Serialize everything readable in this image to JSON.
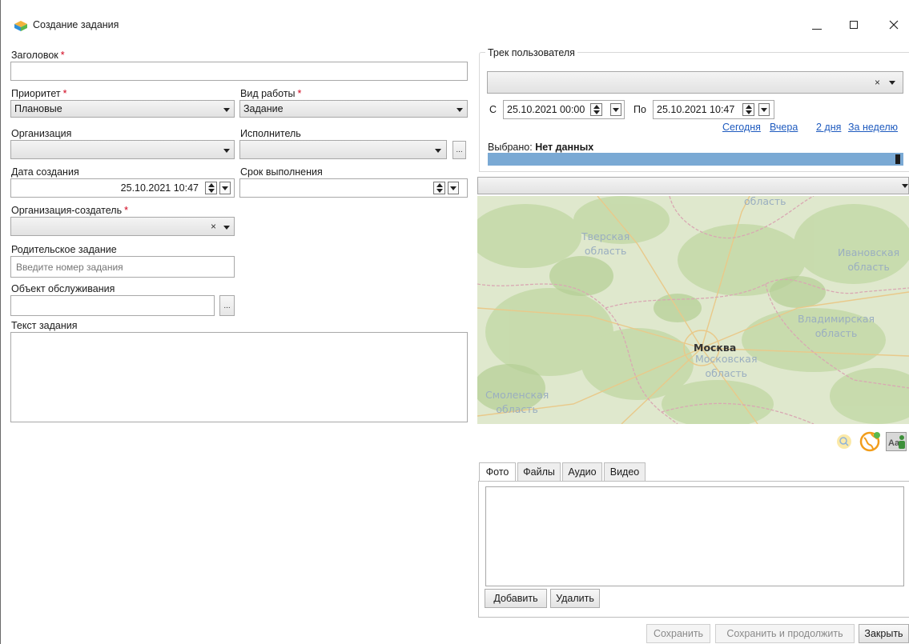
{
  "window": {
    "title": "Создание задания",
    "controls": [
      "minimize",
      "maximize",
      "close"
    ]
  },
  "form": {
    "title_label": "Заголовок",
    "title_value": "",
    "priority_label": "Приоритет",
    "priority_value": "Плановые",
    "worktype_label": "Вид работы",
    "worktype_value": "Задание",
    "org_label": "Организация",
    "org_value": "",
    "executor_label": "Исполнитель",
    "executor_value": "",
    "created_label": "Дата создания",
    "created_value": "25.10.2021 10:47",
    "deadline_label": "Срок выполнения",
    "deadline_value": "",
    "creator_org_label": "Организация-создатель",
    "creator_org_value": "",
    "parent_label": "Родительское задание",
    "parent_placeholder": "Введите номер задания",
    "object_label": "Объект обслуживания",
    "object_value": "",
    "text_label": "Текст задания",
    "text_value": "",
    "required_mark": "*",
    "ellipsis": "..."
  },
  "track": {
    "group_label": "Трек пользователя",
    "user_value": "",
    "from_label": "С",
    "from_value": "25.10.2021 00:00",
    "to_label": "По",
    "to_value": "25.10.2021 10:47",
    "quick_links": [
      "Сегодня",
      "Вчера",
      "2 дня",
      "За неделю"
    ],
    "selected_label": "Выбрано:",
    "selected_value": "Нет данных"
  },
  "map": {
    "layer_value": "",
    "labels": {
      "top": "область",
      "tver": "Тверская\nобласть",
      "ivanovo": "Ивановская\nобласть",
      "vladimir": "Владимирская\nобласть",
      "moscow_city": "Москва",
      "moscow_region": "Московская\nобласть",
      "smolensk": "Смоленская\nобласть"
    },
    "tools": [
      "search-icon",
      "globe-icon",
      "user-label-icon"
    ],
    "colors": {
      "land": "#dfe8cd",
      "forest": "#c4d9a8",
      "road": "#e9c98a",
      "border": "#d9a8b3"
    }
  },
  "attachments": {
    "tabs": [
      "Фото",
      "Файлы",
      "Аудио",
      "Видео"
    ],
    "active_tab": "Фото",
    "add_label": "Добавить",
    "delete_label": "Удалить"
  },
  "footer": {
    "save_label": "Сохранить",
    "save_continue_label": "Сохранить и продолжить",
    "close_label": "Закрыть"
  },
  "colors": {
    "required": "#d0021b",
    "link": "#1f5bbf",
    "progress": "#7aa9d4"
  }
}
